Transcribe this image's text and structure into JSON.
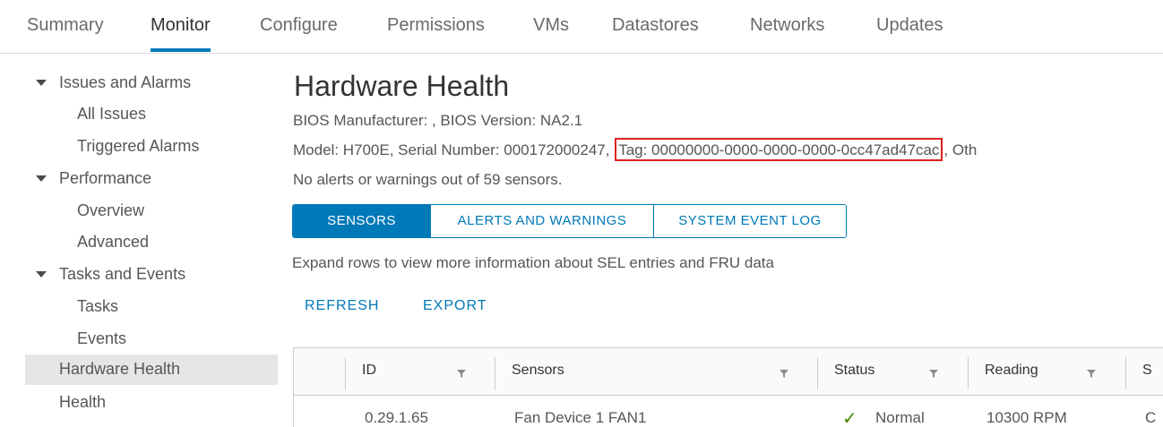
{
  "tabs": [
    {
      "label": "Summary"
    },
    {
      "label": "Monitor",
      "active": true
    },
    {
      "label": "Configure"
    },
    {
      "label": "Permissions"
    },
    {
      "label": "VMs"
    },
    {
      "label": "Datastores"
    },
    {
      "label": "Networks"
    },
    {
      "label": "Updates"
    }
  ],
  "sidebar": {
    "items": [
      {
        "label": "Issues and Alarms",
        "type": "group"
      },
      {
        "label": "All Issues",
        "type": "child"
      },
      {
        "label": "Triggered Alarms",
        "type": "child"
      },
      {
        "label": "Performance",
        "type": "group"
      },
      {
        "label": "Overview",
        "type": "child"
      },
      {
        "label": "Advanced",
        "type": "child"
      },
      {
        "label": "Tasks and Events",
        "type": "group"
      },
      {
        "label": "Tasks",
        "type": "child"
      },
      {
        "label": "Events",
        "type": "child"
      },
      {
        "label": "Hardware Health",
        "type": "top",
        "selected": true
      },
      {
        "label": "Health",
        "type": "top"
      }
    ]
  },
  "main": {
    "title": "Hardware Health",
    "bios_line": "BIOS Manufacturer: , BIOS Version: NA2.1",
    "model_prefix": "Model: H700E, Serial Number: 000172000247,",
    "tag_text": "Tag: 00000000-0000-0000-0000-0cc47ad47cac",
    "model_suffix": ", Oth",
    "alerts_summary": "No alerts or warnings out of 59 sensors.",
    "segments": [
      {
        "label": "SENSORS",
        "active": true
      },
      {
        "label": "ALERTS AND WARNINGS"
      },
      {
        "label": "SYSTEM EVENT LOG"
      }
    ],
    "hint": "Expand rows to view more information about SEL entries and FRU data",
    "actions": {
      "refresh": "REFRESH",
      "export": "EXPORT"
    },
    "grid": {
      "columns": [
        "ID",
        "Sensors",
        "Status",
        "Reading",
        "S"
      ],
      "rows": [
        {
          "id": "0.29.1.65",
          "sensor": "Fan Device 1 FAN1",
          "status": "Normal",
          "reading": "10300 RPM",
          "extra": "C"
        }
      ]
    }
  },
  "colors": {
    "accent": "#0079b8",
    "highlight_box": "#e02020",
    "status_ok": "#3c8500"
  }
}
